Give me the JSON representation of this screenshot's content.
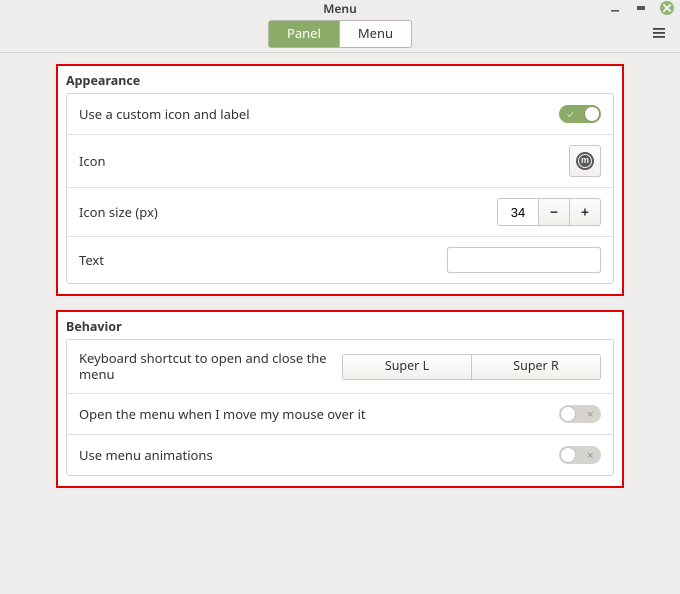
{
  "window": {
    "title": "Menu"
  },
  "tabs": {
    "panel": "Panel",
    "menu": "Menu",
    "active": "panel"
  },
  "appearance": {
    "title": "Appearance",
    "custom_icon_label": "Use a custom icon and label",
    "custom_icon_on": true,
    "icon_label": "Icon",
    "icon_size_label": "Icon size (px)",
    "icon_size_value": "34",
    "text_label": "Text",
    "text_value": ""
  },
  "behavior": {
    "title": "Behavior",
    "shortcut_label": "Keyboard shortcut to open and close the menu",
    "shortcut_a": "Super L",
    "shortcut_b": "Super R",
    "hover_open_label": "Open the menu when I move my mouse over it",
    "hover_open_on": false,
    "animations_label": "Use menu animations",
    "animations_on": false
  },
  "glyphs": {
    "check": "✓",
    "cross": "✕",
    "minus": "−",
    "plus": "+",
    "mint": "m"
  }
}
